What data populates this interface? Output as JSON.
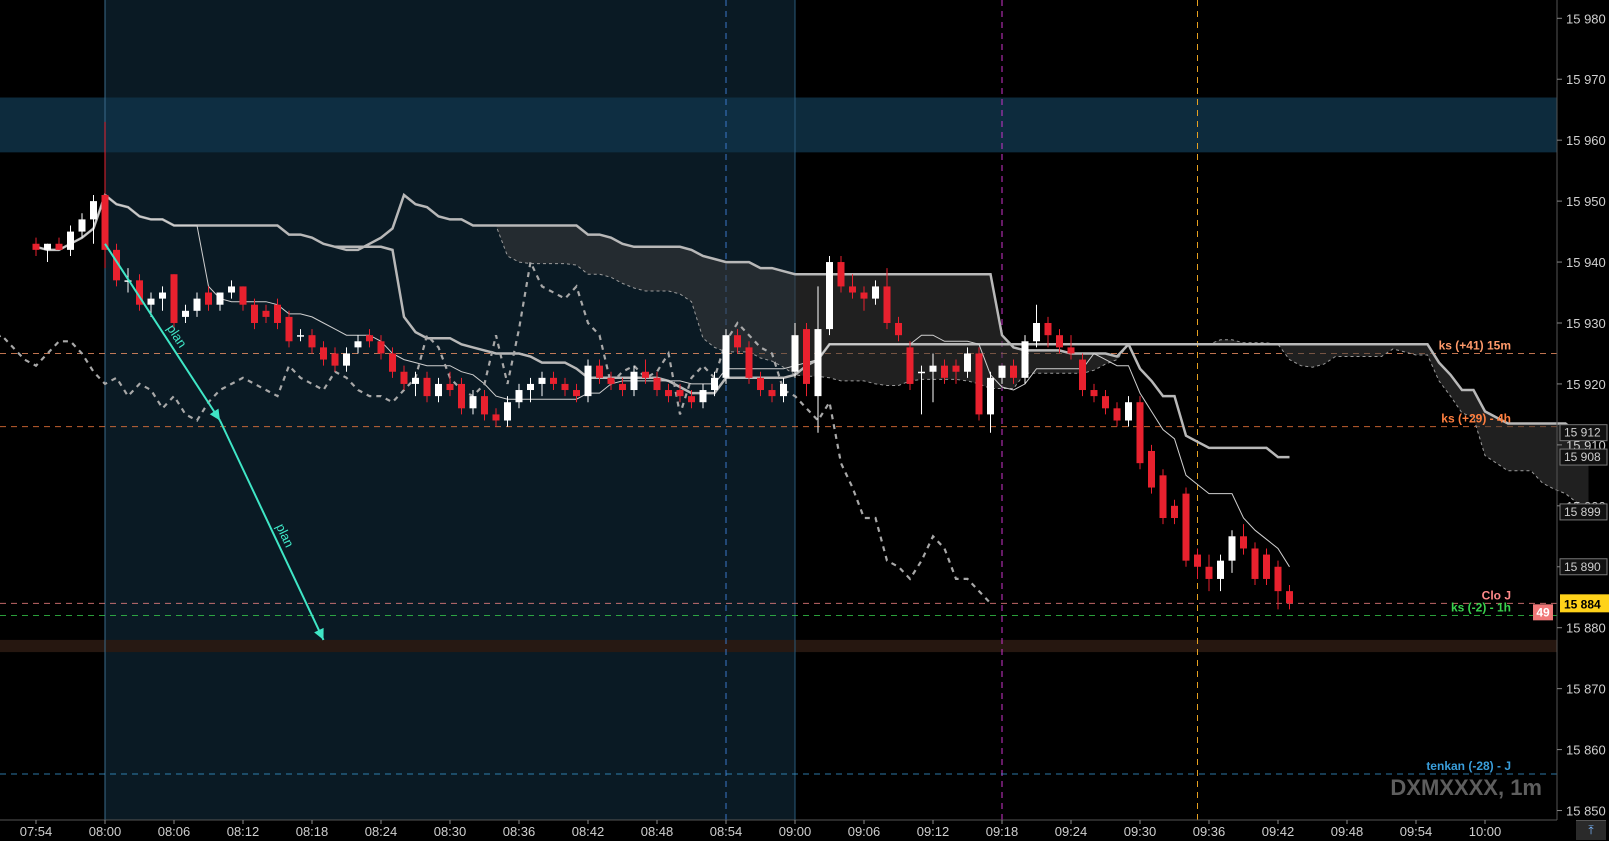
{
  "symbol": "DXMXXXX, 1m",
  "scroll_icon": "scroll-to-latest-icon",
  "colors": {
    "background": "#000000",
    "session_zone": "#0a1a24",
    "bull": "#ffffff",
    "bear": "#e8212e",
    "cloud_line": "#b8b8b8",
    "chikou": "#a8a8a8",
    "plan_arrow": "#3fe6c6"
  },
  "chart_data": {
    "type": "candlestick",
    "x_ticks": [
      "07:54",
      "08:00",
      "08:06",
      "08:12",
      "08:18",
      "08:24",
      "08:30",
      "08:36",
      "08:42",
      "08:48",
      "08:54",
      "09:00",
      "09:06",
      "09:12",
      "09:18",
      "09:24",
      "09:30",
      "09:36",
      "09:42",
      "09:48",
      "09:54",
      "10:00"
    ],
    "y_ticks": [
      "15 980",
      "15 970",
      "15 960",
      "15 950",
      "15 940",
      "15 930",
      "15 920",
      "15 910",
      "15 900",
      "15 890",
      "15 880",
      "15 870",
      "15 860",
      "15 850"
    ],
    "y_range": [
      15845,
      15983
    ],
    "level_labels": [
      {
        "text": "ks (+41) 15m",
        "price": 15925,
        "color": "#ff9a6a"
      },
      {
        "text": "ks (+29) - 4h",
        "price": 15913,
        "color": "#ff7f3f"
      },
      {
        "text": "Clo J",
        "price": 15884,
        "color": "#ff8a8a"
      },
      {
        "text": "ks (-2) - 1h",
        "price": 15882,
        "color": "#39d34e"
      },
      {
        "text": "tenkan (-28) - J",
        "price": 15856,
        "color": "#3a9edb"
      }
    ],
    "price_boxes": [
      {
        "text": "15 912",
        "price": 15912
      },
      {
        "text": "15 908",
        "price": 15908
      },
      {
        "text": "15 899",
        "price": 15899
      },
      {
        "text": "15 890",
        "price": 15890
      }
    ],
    "current_price": {
      "text": "15 884",
      "price": 15884
    },
    "countdown": "49",
    "plan_labels": [
      "plan",
      "plan"
    ],
    "resistance_zone": [
      15958,
      15967
    ],
    "support_zone": [
      15876,
      15878
    ],
    "vertical_markers": [
      {
        "time": "08:00",
        "color": "#3a6a8a"
      },
      {
        "time": "08:54",
        "color": "#3a77c8"
      },
      {
        "time": "09:00",
        "color": "#2a5a7a"
      },
      {
        "time": "09:18",
        "color": "#cc33cc"
      },
      {
        "time": "09:35",
        "color": "#e6a020"
      }
    ],
    "candles": [
      {
        "t": "07:54",
        "o": 15943,
        "h": 15944,
        "l": 15941,
        "c": 15942
      },
      {
        "t": "07:55",
        "o": 15942,
        "h": 15943,
        "l": 15940,
        "c": 15943
      },
      {
        "t": "07:56",
        "o": 15943,
        "h": 15944,
        "l": 15942,
        "c": 15942
      },
      {
        "t": "07:57",
        "o": 15942,
        "h": 15946,
        "l": 15941,
        "c": 15945
      },
      {
        "t": "07:58",
        "o": 15945,
        "h": 15948,
        "l": 15944,
        "c": 15947
      },
      {
        "t": "07:59",
        "o": 15947,
        "h": 15951,
        "l": 15943,
        "c": 15950
      },
      {
        "t": "08:00",
        "o": 15951,
        "h": 15963,
        "l": 15939,
        "c": 15942
      },
      {
        "t": "08:01",
        "o": 15942,
        "h": 15943,
        "l": 15936,
        "c": 15937
      },
      {
        "t": "08:02",
        "o": 15937,
        "h": 15939,
        "l": 15935,
        "c": 15937
      },
      {
        "t": "08:03",
        "o": 15937,
        "h": 15938,
        "l": 15932,
        "c": 15933
      },
      {
        "t": "08:04",
        "o": 15933,
        "h": 15935,
        "l": 15931,
        "c": 15934
      },
      {
        "t": "08:05",
        "o": 15934,
        "h": 15936,
        "l": 15932,
        "c": 15935
      },
      {
        "t": "08:06",
        "o": 15938,
        "h": 15938,
        "l": 15929,
        "c": 15930
      },
      {
        "t": "08:07",
        "o": 15931,
        "h": 15933,
        "l": 15930,
        "c": 15932
      },
      {
        "t": "08:08",
        "o": 15932,
        "h": 15935,
        "l": 15931,
        "c": 15934
      },
      {
        "t": "08:09",
        "o": 15935,
        "h": 15936,
        "l": 15932,
        "c": 15933
      },
      {
        "t": "08:10",
        "o": 15933,
        "h": 15935,
        "l": 15932,
        "c": 15935
      },
      {
        "t": "08:11",
        "o": 15935,
        "h": 15937,
        "l": 15934,
        "c": 15936
      },
      {
        "t": "08:12",
        "o": 15936,
        "h": 15936,
        "l": 15932,
        "c": 15933
      },
      {
        "t": "08:13",
        "o": 15933,
        "h": 15934,
        "l": 15929,
        "c": 15930
      },
      {
        "t": "08:14",
        "o": 15932,
        "h": 15933,
        "l": 15930,
        "c": 15931
      },
      {
        "t": "08:15",
        "o": 15933,
        "h": 15934,
        "l": 15929,
        "c": 15930
      },
      {
        "t": "08:16",
        "o": 15931,
        "h": 15932,
        "l": 15926,
        "c": 15927
      },
      {
        "t": "08:17",
        "o": 15928,
        "h": 15929,
        "l": 15927,
        "c": 15928
      },
      {
        "t": "08:18",
        "o": 15928,
        "h": 15929,
        "l": 15925,
        "c": 15926
      },
      {
        "t": "08:19",
        "o": 15926,
        "h": 15927,
        "l": 15923,
        "c": 15924
      },
      {
        "t": "08:20",
        "o": 15925,
        "h": 15926,
        "l": 15922,
        "c": 15923
      },
      {
        "t": "08:21",
        "o": 15923,
        "h": 15926,
        "l": 15922,
        "c": 15925
      },
      {
        "t": "08:22",
        "o": 15926,
        "h": 15928,
        "l": 15925,
        "c": 15927
      },
      {
        "t": "08:23",
        "o": 15928,
        "h": 15929,
        "l": 15926,
        "c": 15927
      },
      {
        "t": "08:24",
        "o": 15927,
        "h": 15928,
        "l": 15924,
        "c": 15925
      },
      {
        "t": "08:25",
        "o": 15925,
        "h": 15926,
        "l": 15921,
        "c": 15922
      },
      {
        "t": "08:26",
        "o": 15922,
        "h": 15923,
        "l": 15919,
        "c": 15920
      },
      {
        "t": "08:27",
        "o": 15920,
        "h": 15922,
        "l": 15918,
        "c": 15921
      },
      {
        "t": "08:28",
        "o": 15921,
        "h": 15922,
        "l": 15917,
        "c": 15918
      },
      {
        "t": "08:29",
        "o": 15918,
        "h": 15921,
        "l": 15917,
        "c": 15920
      },
      {
        "t": "08:30",
        "o": 15920,
        "h": 15922,
        "l": 15918,
        "c": 15919
      },
      {
        "t": "08:31",
        "o": 15920,
        "h": 15921,
        "l": 15915,
        "c": 15916
      },
      {
        "t": "08:32",
        "o": 15916,
        "h": 15919,
        "l": 15915,
        "c": 15918
      },
      {
        "t": "08:33",
        "o": 15918,
        "h": 15919,
        "l": 15914,
        "c": 15915
      },
      {
        "t": "08:34",
        "o": 15915,
        "h": 15916,
        "l": 15913,
        "c": 15914
      },
      {
        "t": "08:35",
        "o": 15914,
        "h": 15918,
        "l": 15913,
        "c": 15917
      },
      {
        "t": "08:36",
        "o": 15917,
        "h": 15920,
        "l": 15916,
        "c": 15919
      },
      {
        "t": "08:37",
        "o": 15919,
        "h": 15921,
        "l": 15917,
        "c": 15920
      },
      {
        "t": "08:38",
        "o": 15920,
        "h": 15922,
        "l": 15918,
        "c": 15921
      },
      {
        "t": "08:39",
        "o": 15921,
        "h": 15922,
        "l": 15919,
        "c": 15920
      },
      {
        "t": "08:40",
        "o": 15920,
        "h": 15921,
        "l": 15918,
        "c": 15919
      },
      {
        "t": "08:41",
        "o": 15919,
        "h": 15920,
        "l": 15917,
        "c": 15918
      },
      {
        "t": "08:42",
        "o": 15918,
        "h": 15924,
        "l": 15917,
        "c": 15923
      },
      {
        "t": "08:43",
        "o": 15923,
        "h": 15924,
        "l": 15920,
        "c": 15921
      },
      {
        "t": "08:44",
        "o": 15921,
        "h": 15922,
        "l": 15919,
        "c": 15920
      },
      {
        "t": "08:45",
        "o": 15920,
        "h": 15921,
        "l": 15918,
        "c": 15919
      },
      {
        "t": "08:46",
        "o": 15919,
        "h": 15923,
        "l": 15918,
        "c": 15922
      },
      {
        "t": "08:47",
        "o": 15922,
        "h": 15924,
        "l": 15920,
        "c": 15921
      },
      {
        "t": "08:48",
        "o": 15921,
        "h": 15922,
        "l": 15918,
        "c": 15919
      },
      {
        "t": "08:49",
        "o": 15919,
        "h": 15920,
        "l": 15917,
        "c": 15918
      },
      {
        "t": "08:50",
        "o": 15919,
        "h": 15920,
        "l": 15917,
        "c": 15918
      },
      {
        "t": "08:51",
        "o": 15918,
        "h": 15919,
        "l": 15916,
        "c": 15917
      },
      {
        "t": "08:52",
        "o": 15917,
        "h": 15920,
        "l": 15916,
        "c": 15919
      },
      {
        "t": "08:53",
        "o": 15919,
        "h": 15922,
        "l": 15918,
        "c": 15921
      },
      {
        "t": "08:54",
        "o": 15921,
        "h": 15929,
        "l": 15920,
        "c": 15928
      },
      {
        "t": "08:55",
        "o": 15928,
        "h": 15929,
        "l": 15925,
        "c": 15926
      },
      {
        "t": "08:56",
        "o": 15926,
        "h": 15927,
        "l": 15920,
        "c": 15921
      },
      {
        "t": "08:57",
        "o": 15921,
        "h": 15922,
        "l": 15918,
        "c": 15919
      },
      {
        "t": "08:58",
        "o": 15919,
        "h": 15920,
        "l": 15917,
        "c": 15918
      },
      {
        "t": "08:59",
        "o": 15918,
        "h": 15921,
        "l": 15917,
        "c": 15920
      },
      {
        "t": "09:00",
        "o": 15922,
        "h": 15930,
        "l": 15921,
        "c": 15928
      },
      {
        "t": "09:01",
        "o": 15929,
        "h": 15930,
        "l": 15918,
        "c": 15920
      },
      {
        "t": "09:02",
        "o": 15918,
        "h": 15936,
        "l": 15912,
        "c": 15929
      },
      {
        "t": "09:03",
        "o": 15929,
        "h": 15941,
        "l": 15928,
        "c": 15940
      },
      {
        "t": "09:04",
        "o": 15940,
        "h": 15941,
        "l": 15935,
        "c": 15936
      },
      {
        "t": "09:05",
        "o": 15936,
        "h": 15938,
        "l": 15934,
        "c": 15935
      },
      {
        "t": "09:06",
        "o": 15935,
        "h": 15936,
        "l": 15932,
        "c": 15934
      },
      {
        "t": "09:07",
        "o": 15934,
        "h": 15937,
        "l": 15933,
        "c": 15936
      },
      {
        "t": "09:08",
        "o": 15936,
        "h": 15939,
        "l": 15929,
        "c": 15930
      },
      {
        "t": "09:09",
        "o": 15930,
        "h": 15931,
        "l": 15927,
        "c": 15928
      },
      {
        "t": "09:10",
        "o": 15926,
        "h": 15927,
        "l": 15919,
        "c": 15920
      },
      {
        "t": "09:11",
        "o": 15922,
        "h": 15923,
        "l": 15915,
        "c": 15922
      },
      {
        "t": "09:12",
        "o": 15922,
        "h": 15925,
        "l": 15917,
        "c": 15923
      },
      {
        "t": "09:13",
        "o": 15923,
        "h": 15924,
        "l": 15920,
        "c": 15921
      },
      {
        "t": "09:14",
        "o": 15923,
        "h": 15924,
        "l": 15920,
        "c": 15922
      },
      {
        "t": "09:15",
        "o": 15922,
        "h": 15926,
        "l": 15921,
        "c": 15925
      },
      {
        "t": "09:16",
        "o": 15925,
        "h": 15926,
        "l": 15914,
        "c": 15915
      },
      {
        "t": "09:17",
        "o": 15915,
        "h": 15922,
        "l": 15912,
        "c": 15921
      },
      {
        "t": "09:18",
        "o": 15921,
        "h": 15923,
        "l": 15920,
        "c": 15923
      },
      {
        "t": "09:19",
        "o": 15923,
        "h": 15924,
        "l": 15920,
        "c": 15921
      },
      {
        "t": "09:20",
        "o": 15921,
        "h": 15928,
        "l": 15920,
        "c": 15927
      },
      {
        "t": "09:21",
        "o": 15927,
        "h": 15933,
        "l": 15926,
        "c": 15930
      },
      {
        "t": "09:22",
        "o": 15930,
        "h": 15931,
        "l": 15926,
        "c": 15928
      },
      {
        "t": "09:23",
        "o": 15928,
        "h": 15929,
        "l": 15925,
        "c": 15926
      },
      {
        "t": "09:24",
        "o": 15926,
        "h": 15928,
        "l": 15924,
        "c": 15925
      },
      {
        "t": "09:25",
        "o": 15924,
        "h": 15925,
        "l": 15918,
        "c": 15919
      },
      {
        "t": "09:26",
        "o": 15919,
        "h": 15920,
        "l": 15917,
        "c": 15918
      },
      {
        "t": "09:27",
        "o": 15918,
        "h": 15919,
        "l": 15915,
        "c": 15916
      },
      {
        "t": "09:28",
        "o": 15916,
        "h": 15917,
        "l": 15913,
        "c": 15914
      },
      {
        "t": "09:29",
        "o": 15914,
        "h": 15918,
        "l": 15913,
        "c": 15917
      },
      {
        "t": "09:30",
        "o": 15917,
        "h": 15918,
        "l": 15906,
        "c": 15907
      },
      {
        "t": "09:31",
        "o": 15909,
        "h": 15910,
        "l": 15902,
        "c": 15903
      },
      {
        "t": "09:32",
        "o": 15905,
        "h": 15906,
        "l": 15897,
        "c": 15898
      },
      {
        "t": "09:33",
        "o": 15900,
        "h": 15901,
        "l": 15897,
        "c": 15898
      },
      {
        "t": "09:34",
        "o": 15902,
        "h": 15903,
        "l": 15890,
        "c": 15891
      },
      {
        "t": "09:35",
        "o": 15892,
        "h": 15893,
        "l": 15888,
        "c": 15890
      },
      {
        "t": "09:36",
        "o": 15890,
        "h": 15892,
        "l": 15886,
        "c": 15888
      },
      {
        "t": "09:37",
        "o": 15888,
        "h": 15892,
        "l": 15886,
        "c": 15891
      },
      {
        "t": "09:38",
        "o": 15891,
        "h": 15896,
        "l": 15889,
        "c": 15895
      },
      {
        "t": "09:39",
        "o": 15895,
        "h": 15897,
        "l": 15892,
        "c": 15893
      },
      {
        "t": "09:40",
        "o": 15893,
        "h": 15894,
        "l": 15887,
        "c": 15888
      },
      {
        "t": "09:41",
        "o": 15892,
        "h": 15893,
        "l": 15887,
        "c": 15888
      },
      {
        "t": "09:42",
        "o": 15890,
        "h": 15891,
        "l": 15883,
        "c": 15886
      },
      {
        "t": "09:43",
        "o": 15886,
        "h": 15887,
        "l": 15883,
        "c": 15884
      }
    ]
  }
}
